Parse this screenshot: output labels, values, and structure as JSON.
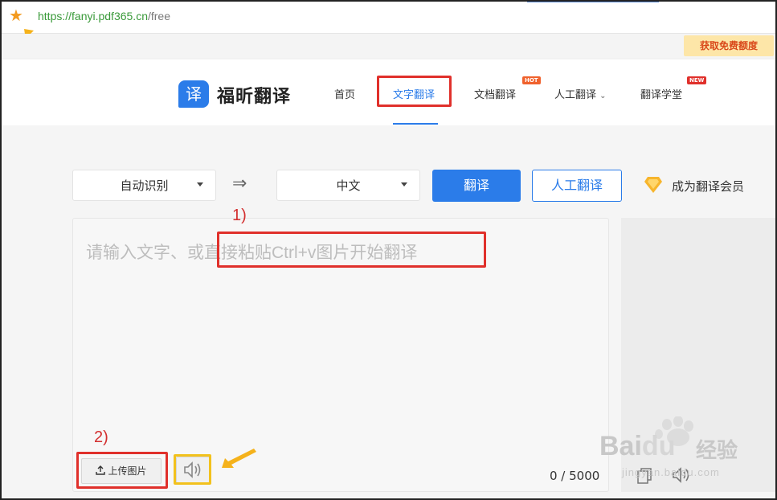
{
  "browser": {
    "url_scheme_host": "https://fanyi.pdf365.cn",
    "url_path": "/free"
  },
  "promo": {
    "label": "获取免费额度"
  },
  "header": {
    "logo_glyph": "译",
    "logo_text": "福昕翻译",
    "nav": [
      {
        "label": "首页"
      },
      {
        "label": "文字翻译",
        "active": true
      },
      {
        "label": "文档翻译",
        "badge": "HOT"
      },
      {
        "label": "人工翻译",
        "suffix": "⌄"
      },
      {
        "label": "翻译学堂",
        "badge": "NEW"
      }
    ]
  },
  "toolbar": {
    "source_lang": "自动识别",
    "target_lang": "中文",
    "translate_label": "翻译",
    "human_label": "人工翻译",
    "vip_label": "成为翻译会员"
  },
  "editor": {
    "placeholder": "请输入文字、或直接粘贴Ctrl+v图片开始翻译",
    "upload_label": "上传图片",
    "counter": "0 / 5000"
  },
  "annotations": {
    "label1": "1)",
    "label2": "2)"
  },
  "watermark": {
    "brand": "Bai",
    "brand2": "du",
    "cn": "经验",
    "sub": "jingyan.baidu.com"
  },
  "colors": {
    "accent": "#2b7ce9",
    "annotation_red": "#e0302b",
    "annotation_yellow": "#f2c11d",
    "arrow": "#f5b21b"
  }
}
